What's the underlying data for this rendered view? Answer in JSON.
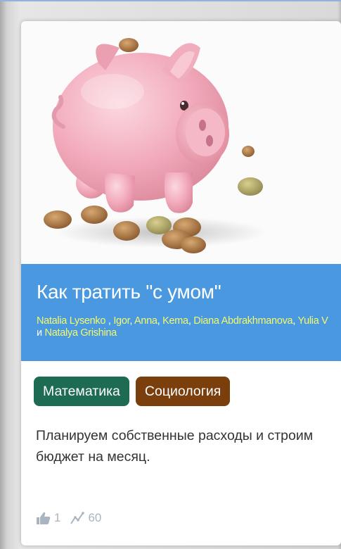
{
  "card": {
    "image": {
      "alt_subject": "piggy-bank-with-coins"
    },
    "title": "Как тратить \"с умом\"",
    "authors": {
      "a1": "Natalia Lysenko",
      "sep1": " , ",
      "a2": "Igor",
      "sep2": ", ",
      "a3": "Anna",
      "sep3": ", ",
      "a4": "Kema",
      "sep4": ", ",
      "a5": "Diana Abdrakhmanova",
      "sep5": ", ",
      "a6": "Yulia V",
      "conj": " и ",
      "a7": "Natalya Grishina"
    },
    "tags": [
      {
        "label": "Математика",
        "color": "#1c6b52"
      },
      {
        "label": "Социология",
        "color": "#7a3f0c"
      }
    ],
    "description": "Планируем собственные расходы и строим бюджет на месяц.",
    "stats": {
      "likes": "1",
      "views": "60"
    }
  },
  "colors": {
    "title_bar": "#4a99e0",
    "author_link": "#f4f86b",
    "stats_text": "#aab4c0"
  }
}
